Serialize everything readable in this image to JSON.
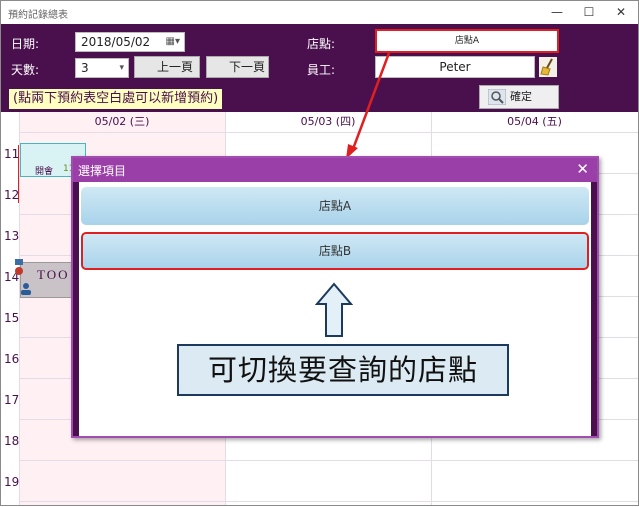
{
  "window": {
    "title": "預約記錄總表",
    "minimize": "—",
    "maximize": "☐",
    "close": "✕"
  },
  "toolbar": {
    "date_label": "日期:",
    "date_value": "2018/05/02",
    "days_label": "天數:",
    "days_value": "3",
    "prev_label": "上一頁",
    "next_label": "下一頁",
    "store_label": "店點:",
    "store_value": "店點A",
    "staff_label": "員工:",
    "staff_value": "Peter",
    "hint": "(點兩下預約表空白處可以新增預約)",
    "confirm_label": "確定"
  },
  "calendar": {
    "columns": [
      "05/02 (三)",
      "05/03 (四)",
      "05/04 (五)"
    ],
    "hours": [
      "11",
      "12",
      "13",
      "14",
      "15",
      "16",
      "17",
      "18",
      "19"
    ],
    "events": [
      {
        "label": "開會",
        "time": "11"
      },
      {
        "label": "TOO"
      }
    ]
  },
  "popup": {
    "title": "選擇項目",
    "close": "✕",
    "options": [
      "店點A",
      "店點B"
    ]
  },
  "annotation": {
    "callout": "可切換要查詢的店點"
  },
  "colors": {
    "toolbar_bg": "#4a0f4d",
    "popup_header": "#9b3fa8",
    "highlight": "#e02020"
  }
}
